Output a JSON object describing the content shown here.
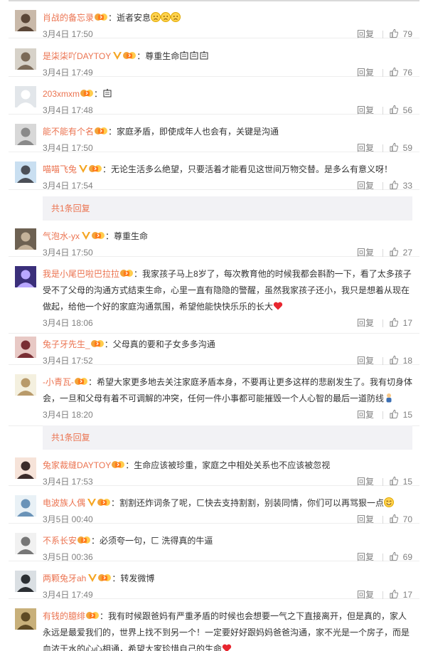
{
  "reply_label": "回复",
  "colors": {
    "username": "#eb7350",
    "meta": "#808080",
    "sub_bg": "#f2f2f5"
  },
  "comments": [
    {
      "user": "肖战的备忘录",
      "text": "：逝者安息",
      "emoji": [
        "sad-face",
        "sad-face",
        "sad-face"
      ],
      "time": "3月4日 17:50",
      "likes": "79",
      "vip": false
    },
    {
      "user": "是柒柒吖DAYTOY",
      "text": "：尊重生命",
      "emoji": [
        "candle",
        "candle",
        "candle"
      ],
      "time": "3月4日 17:49",
      "likes": "76",
      "vip": true
    },
    {
      "user": "203xmxm",
      "text": "：",
      "emoji": [
        "candle"
      ],
      "time": "3月4日 17:48",
      "likes": "56",
      "vip": false
    },
    {
      "user": "能不能有个名",
      "text": "：家庭矛盾，即使成年人也会有，关键是沟通",
      "emoji": [],
      "time": "3月4日 17:50",
      "likes": "59",
      "vip": false
    },
    {
      "user": "喵喵飞兔",
      "text": "：无论生活多么绝望，只要活着才能看见这世间万物交替。是多么有意义呀！",
      "emoji": [],
      "time": "3月4日 17:54",
      "likes": "33",
      "vip": true
    },
    {
      "user": "气泡水-yx",
      "text": "：尊重生命",
      "emoji": [],
      "time": "3月4日 17:50",
      "likes": "27",
      "vip": true
    },
    {
      "user": "我是小尾巴啦巴拉拉",
      "text": "：我家孩子马上8岁了，每次教育他的时候我都会斟酌一下，看了太多孩子受不了父母的沟通方式结束生命，心里一直有隐隐的警醒，虽然我家孩子还小，我只是想着从现在做起，给他一个好的家庭沟通氛围，希望他能快快乐乐的长大",
      "emoji": [
        "heart"
      ],
      "time": "3月4日 18:06",
      "likes": "17",
      "vip": false
    },
    {
      "user": "兔子牙先生_",
      "text": "：父母真的要和子女多多沟通",
      "emoji": [],
      "time": "3月4日 17:52",
      "likes": "18",
      "vip": false
    },
    {
      "user": "-小青瓦-",
      "text": "：希望大家更多地去关注家庭矛盾本身，不要再让更多这样的悲剧发生了。我有切身体会，一旦和父母有着不可调解的冲突，任何一件小事都可能摧毁一个人心智的最后一道防线",
      "emoji": [
        "figure"
      ],
      "time": "3月4日 18:20",
      "likes": "15",
      "vip": false
    },
    {
      "user": "兔家裁缝DAYTOY",
      "text": "：生命应该被珍重，家庭之中相处关系也不应该被忽视",
      "emoji": [],
      "time": "3月4日 17:53",
      "likes": "15",
      "vip": false
    },
    {
      "user": "电波族人偶",
      "text": "：割割还炸词条了呢，ㄈ快去支持割割，别装同情，你们可以再骂狠一点",
      "emoji": [
        "smile"
      ],
      "time": "3月5日 00:40",
      "likes": "70",
      "vip": true
    },
    {
      "user": "不系长安",
      "text": "：必须夸一句，ㄈ 洗得真的牛逼",
      "emoji": [],
      "time": "3月5日 00:36",
      "likes": "69",
      "vip": false
    },
    {
      "user": "两颗兔牙ah",
      "text": "：转发微博",
      "emoji": [],
      "time": "3月4日 17:49",
      "likes": "17",
      "vip": true
    },
    {
      "user": "有钱的臆绯",
      "text": "：我有时候跟爸妈有严重矛盾的时候也会想要一气之下直接离开，但是真的，家人永远是最爱我们的，世界上找不到另一个！一定要好好跟妈妈爸爸沟通，家不光是一个房子，而是血浓于水的心心相通，希望大家珍惜自己的生命",
      "emoji": [
        "heart"
      ],
      "time": "",
      "likes": "",
      "vip": false
    }
  ],
  "sub_replies": [
    {
      "label": "共1条回复"
    },
    {
      "label": "共1条回复"
    }
  ]
}
